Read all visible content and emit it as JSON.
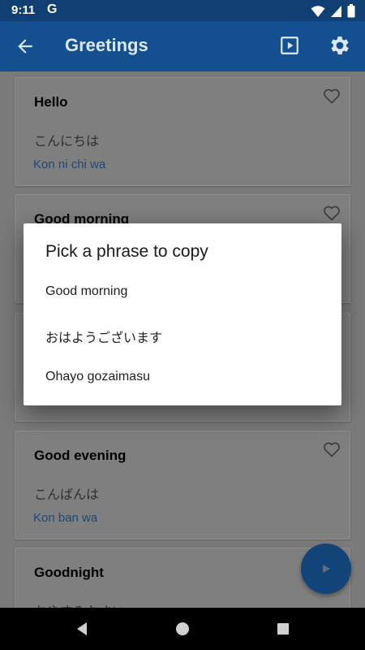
{
  "status": {
    "time": "9:11",
    "google_glyph": "G"
  },
  "appbar": {
    "title": "Greetings",
    "back_icon": "arrow-back-icon",
    "play_icon": "play-box-icon",
    "settings_icon": "gear-icon"
  },
  "cards": [
    {
      "english": "Hello",
      "japanese": "こんにちは",
      "romaji": "Kon ni chi wa"
    },
    {
      "english": "Good morning",
      "japanese": "おはようございます",
      "romaji": "Ohayo gozaimasu"
    },
    {
      "english": "Good evening",
      "japanese": "こんばんは",
      "romaji": "Kon ban wa"
    },
    {
      "english": "Goodnight",
      "japanese": "おやすみなさい",
      "romaji": ""
    }
  ],
  "dialog": {
    "title": "Pick a phrase to copy",
    "options": [
      "Good morning",
      "おはようございます",
      "Ohayo gozaimasu"
    ]
  },
  "colors": {
    "appbar": "#144f8f",
    "statusbar": "#0f3f73",
    "accent_link": "#1e4876",
    "scrim_bg": "#7a7a7a"
  }
}
